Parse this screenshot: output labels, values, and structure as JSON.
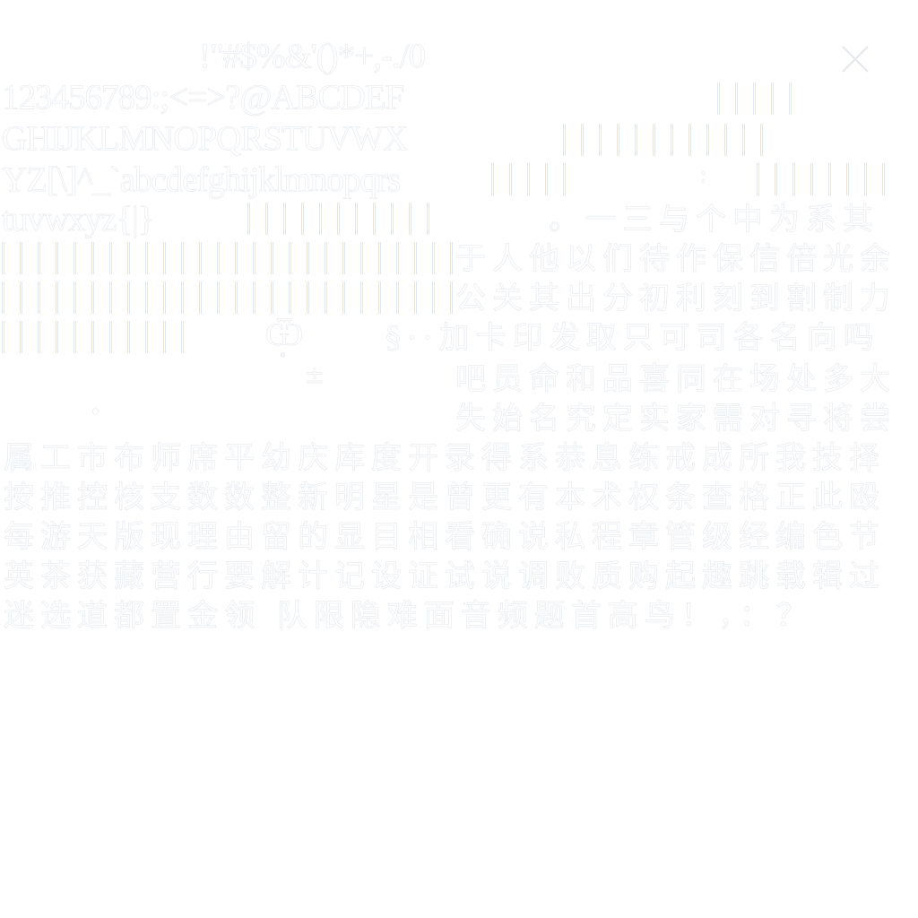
{
  "glyph_atlas": {
    "latin_rows": [
      "!\"#$%&'()*+,-./0",
      "123456789:;<=>?@ABCDEF",
      "GHIJKLMNOPQRSTUVWX",
      "YZ[\\]^_`abcdefghijklmnopqrs",
      "tuvwxyz{|}"
    ],
    "cjk_rows": [
      "。一三与个中为系其",
      "于人他以们待作保信倍光余",
      "公关其出分初利刻到割制力",
      "§··加卡印发取只可司各名向吗",
      "吧员命和品喜同在场处多大",
      "失始名究定实家需对寻将尝",
      "属工市布师席平幼庆库度开录得系恭息练戒成所我技择",
      "按推控核支数数整新明星是曾更有本术权条查格正此殴",
      "每游天版现理由留的显目相看确说私程章管级经编色节",
      "英茶获藏营行要解计记设证试说调败质购起趣跳载辑过",
      "迷选道都置金领 队限隐难面音频题首高鸟！，：？"
    ],
    "close_icon": "close-icon",
    "colors": {
      "glyph_outline": "#e3e8ee",
      "bar_blue": "#dcebf6",
      "bar_beige": "#eee3d2"
    }
  }
}
